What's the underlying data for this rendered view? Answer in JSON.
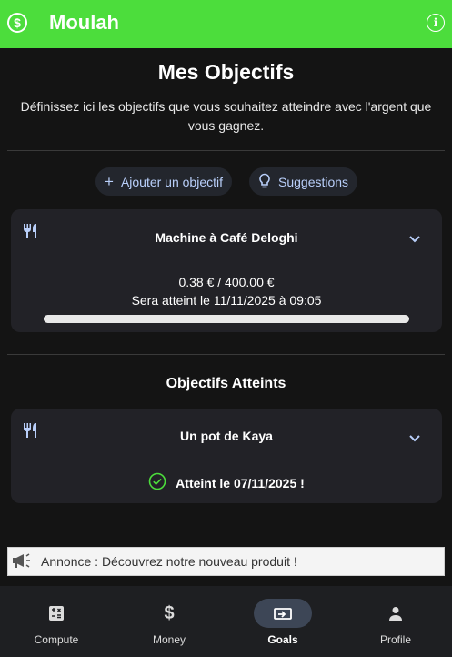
{
  "app": {
    "title": "Moulah"
  },
  "page": {
    "title": "Mes Objectifs",
    "description": "Définissez ici les objectifs que vous souhaitez atteindre avec l'argent que vous gagnez."
  },
  "actions": {
    "add_label": "Ajouter un objectif",
    "suggestions_label": "Suggestions"
  },
  "goals": [
    {
      "name": "Machine à Café Deloghi",
      "icon": "restaurant-icon",
      "amount": "0.38 € / 400.00 €",
      "eta": "Sera atteint le 11/11/2025 à 09:05",
      "progress": 0.00095
    }
  ],
  "achieved_section": {
    "title": "Objectifs Atteints",
    "items": [
      {
        "name": "Un pot de Kaya",
        "icon": "restaurant-icon",
        "status": "Atteint le 07/11/2025 !"
      }
    ]
  },
  "ad": {
    "text": "Annonce : Découvrez notre nouveau produit !"
  },
  "nav": {
    "items": [
      {
        "label": "Compute",
        "icon": "calculator-icon"
      },
      {
        "label": "Money",
        "icon": "dollar-icon"
      },
      {
        "label": "Goals",
        "icon": "money-bill-icon",
        "active": true
      },
      {
        "label": "Profile",
        "icon": "person-icon"
      }
    ]
  },
  "colors": {
    "brand": "#4cdd3c",
    "background": "#141414",
    "card": "#222227",
    "accent": "#b9cffa",
    "success": "#4cdd3c"
  }
}
